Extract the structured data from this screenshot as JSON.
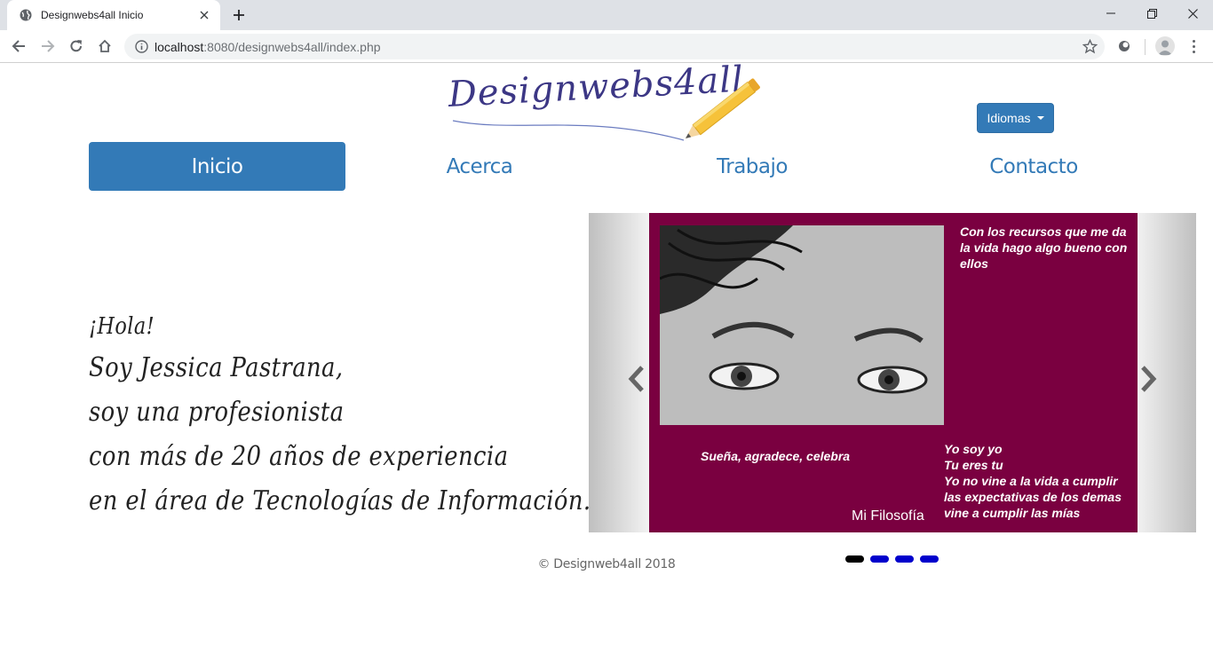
{
  "browser": {
    "tab_title": "Designwebs4all Inicio",
    "url_host": "localhost",
    "url_rest": ":8080/designwebs4all/index.php"
  },
  "site": {
    "logo_text": "Designwebs4all",
    "language_button": "Idiomas",
    "nav": {
      "inicio": "Inicio",
      "acerca": "Acerca",
      "trabajo": "Trabajo",
      "contacto": "Contacto"
    },
    "intro": {
      "line1": "¡Hola!",
      "line2": "Soy Jessica Pastrana,",
      "line3": "soy una profesionista",
      "line4": "con más de 20 años de experiencia",
      "line5": "en el área de Tecnologías de Información."
    },
    "carousel": {
      "quote_top": "Con los recursos que me da la vida hago algo bueno con ellos",
      "quote_left": "Sueña, agradece, celebra",
      "quote_right_lines": [
        "Yo soy yo",
        "Tu eres tu",
        "Yo no vine a la vida a cumplir las expectativas de los demas",
        "vine a cumplir las mías"
      ],
      "caption": "Mi Filosofía",
      "slide_color": "#7a0040",
      "slide_count": 4,
      "active_index": 0
    },
    "footer": "© Designweb4all 2018",
    "accent_color": "#337ab7"
  }
}
